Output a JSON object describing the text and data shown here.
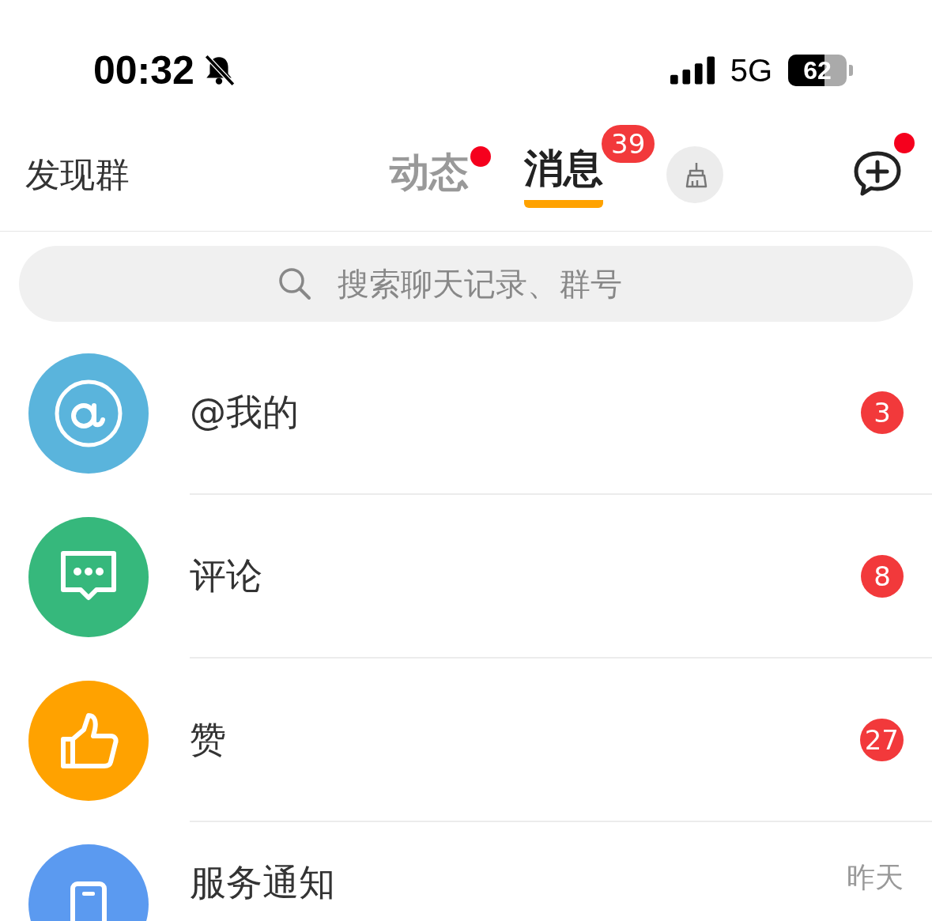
{
  "status_bar": {
    "time": "00:32",
    "network": "5G",
    "battery": "62"
  },
  "header": {
    "discover": "发现群",
    "tabs": [
      {
        "label": "动态",
        "selected": false,
        "dot": true
      },
      {
        "label": "消息",
        "selected": true,
        "badge": "39"
      }
    ],
    "compose_dot": true
  },
  "search": {
    "placeholder": "搜索聊天记录、群号"
  },
  "messages": [
    {
      "kind": "mention",
      "title": "@我的",
      "color": "#5ab4dc",
      "badge": "3"
    },
    {
      "kind": "comment",
      "title": "评论",
      "color": "#36b87c",
      "badge": "8"
    },
    {
      "kind": "like",
      "title": "赞",
      "color": "#ffa200",
      "badge": "27"
    },
    {
      "kind": "service",
      "title": "服务通知",
      "color": "#5b9af0",
      "time": "昨天"
    }
  ]
}
